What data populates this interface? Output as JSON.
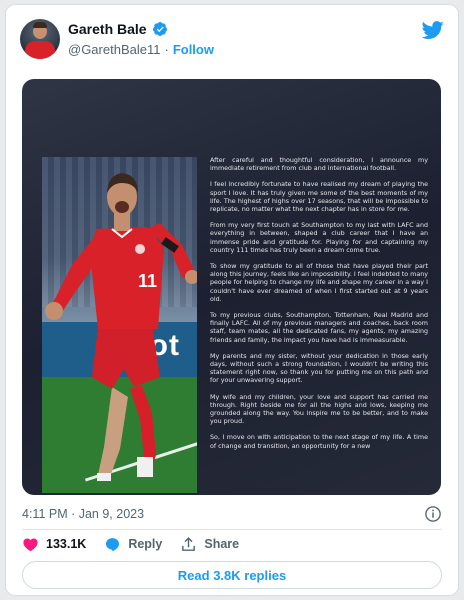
{
  "author": {
    "name": "Gareth Bale",
    "handle": "@GarethBale11",
    "separator": "·",
    "follow_label": "Follow",
    "verified": true
  },
  "media": {
    "board_text": "sot",
    "jersey_number": "11",
    "statement": [
      "After careful and thoughtful consideration, I announce my immediate retirement from club and international football.",
      "I feel incredibly fortunate to have realised my dream of playing the sport I love. It has truly given me some of the best moments of my life. The highest of highs over 17 seasons, that will be impossible to replicate, no matter what the next chapter has in store for me.",
      "From my very first touch at Southampton to my last with LAFC and everything in between, shaped a club career that I have an immense pride and gratitude for. Playing for and captaining my country 111 times has truly been a dream come true.",
      "To show my gratitude to all of those that have played their part along this journey, feels like an impossibility. I feel indebted to many people for helping to change my life and shape my career in a way I couldn't have ever dreamed of when I first started out at 9 years old.",
      "To my previous clubs, Southampton, Tottenham, Real Madrid and finally LAFC. All of my previous managers and coaches, back room staff, team mates, all the dedicated fans, my agents, my amazing friends and family, the impact you have had is immeasurable.",
      "My parents and my sister, without your dedication in those early days, without such a strong foundation, I wouldn't be writing this statement right now, so thank you for putting me on this path and for your unwavering support.",
      "My wife and my children, your love and support has carried me through. Right beside me for all the highs and lows, keeping me grounded along the way. You inspire me to be better, and to make you proud.",
      "So, I move on with anticipation to the next stage of my life. A time of change and transition, an opportunity for a new"
    ]
  },
  "meta": {
    "timestamp": "4:11 PM · Jan 9, 2023"
  },
  "actions": {
    "likes": "133.1K",
    "reply_label": "Reply",
    "share_label": "Share"
  },
  "read_replies_label": "Read 3.8K replies",
  "colors": {
    "accent": "#1d9bf0",
    "like": "#f91880",
    "jersey": "#d82128"
  },
  "icons": [
    "verified-badge-icon",
    "twitter-bird-icon",
    "info-icon",
    "heart-icon",
    "reply-icon",
    "share-icon"
  ]
}
